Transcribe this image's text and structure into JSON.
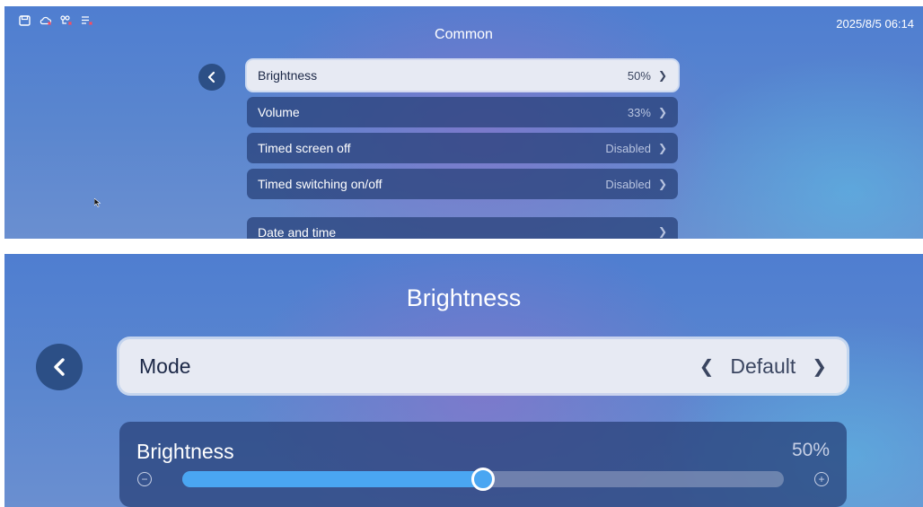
{
  "status": {
    "datetime": "2025/8/5 06:14",
    "icons": [
      "save-icon",
      "cloud-error-icon",
      "sync-error-icon",
      "list-error-icon"
    ],
    "error_color": "#ff4b5c"
  },
  "common": {
    "title": "Common",
    "items": [
      {
        "label": "Brightness",
        "value": "50%",
        "selected": true
      },
      {
        "label": "Volume",
        "value": "33%"
      },
      {
        "label": "Timed screen off",
        "value": "Disabled"
      },
      {
        "label": "Timed switching on/off",
        "value": "Disabled"
      },
      {
        "label": "Date and time",
        "value": ""
      }
    ]
  },
  "brightness_page": {
    "title": "Brightness",
    "mode": {
      "label": "Mode",
      "value": "Default"
    },
    "brightness": {
      "label": "Brightness",
      "value_text": "50%",
      "level": 0.5
    }
  },
  "colors": {
    "accent": "#4aa6f2",
    "card": "#263e76",
    "selected": "#e7eaf3"
  }
}
